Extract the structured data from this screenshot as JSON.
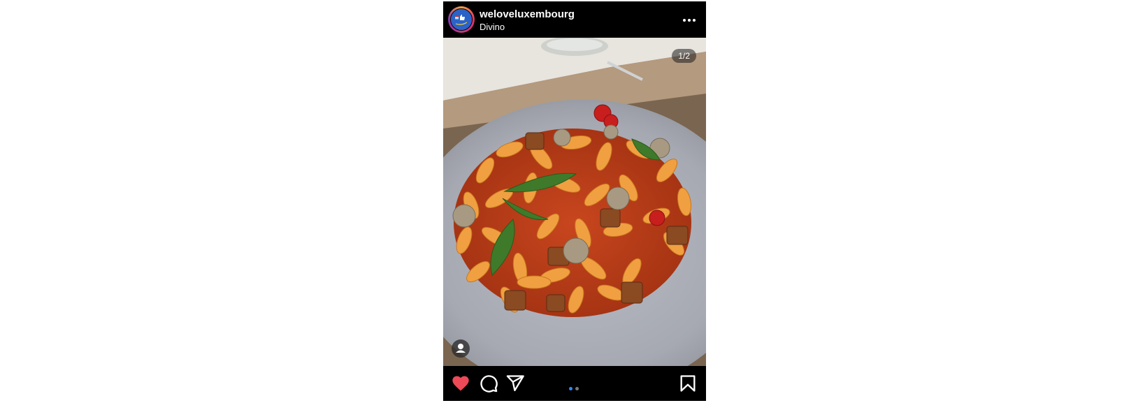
{
  "header": {
    "username": "weloveluxembourg",
    "location": "Divino",
    "avatar_icon": "weloveluxembourg-logo",
    "more_icon": "more-horizontal-icon"
  },
  "photo": {
    "counter": "1/2",
    "description_icon": "pasta-dish-photo",
    "tag_icon": "user-tag-icon"
  },
  "actions": {
    "like_icon": "heart-icon",
    "comment_icon": "comment-icon",
    "share_icon": "send-icon",
    "save_icon": "bookmark-icon",
    "liked": true,
    "carousel": {
      "total": 2,
      "current": 1
    }
  },
  "colors": {
    "like": "#ed4956",
    "active_dot": "#2f89ff",
    "background": "#000000"
  }
}
